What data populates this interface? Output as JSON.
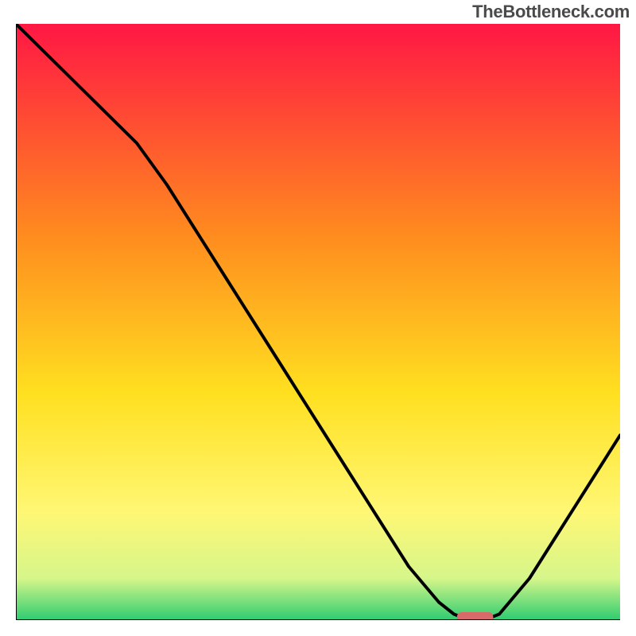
{
  "watermark": "TheBottleneck.com",
  "chart_data": {
    "type": "line",
    "title": "",
    "xlabel": "",
    "ylabel": "",
    "xlim": [
      0,
      100
    ],
    "ylim": [
      0,
      100
    ],
    "x": [
      0,
      5,
      10,
      15,
      20,
      25,
      30,
      35,
      40,
      45,
      50,
      55,
      60,
      65,
      70,
      72.5,
      75,
      77.5,
      80,
      85,
      90,
      95,
      100
    ],
    "values": [
      100,
      95,
      90,
      85,
      80,
      73,
      65,
      57,
      49,
      41,
      33,
      25,
      17,
      9,
      3,
      1,
      0,
      0,
      1,
      7,
      15,
      23,
      31
    ],
    "marker": {
      "x_start": 73,
      "x_end": 79,
      "y": 0
    },
    "gradient_stops": [
      {
        "offset": 0,
        "color": "#ff1744"
      },
      {
        "offset": 35,
        "color": "#ff8a1f"
      },
      {
        "offset": 62,
        "color": "#ffe020"
      },
      {
        "offset": 82,
        "color": "#fff775"
      },
      {
        "offset": 93,
        "color": "#d6f68a"
      },
      {
        "offset": 100,
        "color": "#2ecc71"
      }
    ]
  }
}
